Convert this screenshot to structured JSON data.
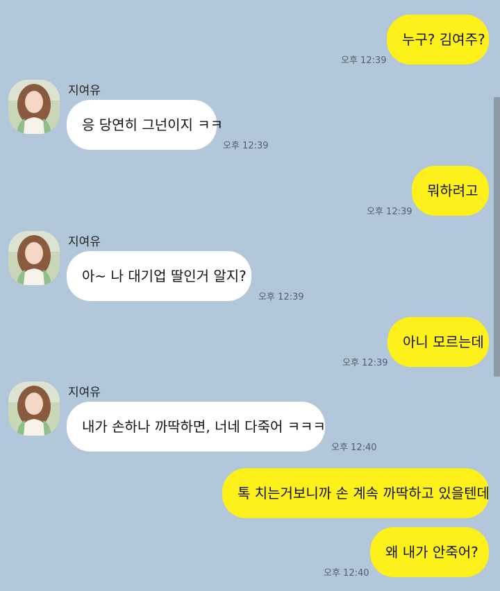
{
  "chat": {
    "messages": [
      {
        "side": "me",
        "text": "누구? 김여주?",
        "time": "오후 12:39"
      },
      {
        "side": "them",
        "sender": "지여유",
        "text": "응 당연히 그넌이지 ㅋㅋ",
        "time": "오후 12:39"
      },
      {
        "side": "me",
        "text": "뭐하려고",
        "time": "오후 12:39"
      },
      {
        "side": "them",
        "sender": "지여유",
        "text": "아~ 나 대기업 딸인거 알지?",
        "time": "오후 12:39"
      },
      {
        "side": "me",
        "text": "아니 모르는데",
        "time": "오후 12:39"
      },
      {
        "side": "them",
        "sender": "지여유",
        "text": "내가 손하나 까딱하면, 너네 다죽어 ㅋㅋㅋ",
        "time": "오후 12:40"
      },
      {
        "side": "me",
        "text": "톡 치는거보니까 손 계속 까딱하고 있을텐데",
        "time": ""
      },
      {
        "side": "me",
        "text": "왜 내가 안죽어?",
        "time": "오후 12:40"
      }
    ]
  },
  "colors": {
    "background": "#b2c7d9",
    "my_bubble": "#fef01b",
    "their_bubble": "#ffffff"
  }
}
